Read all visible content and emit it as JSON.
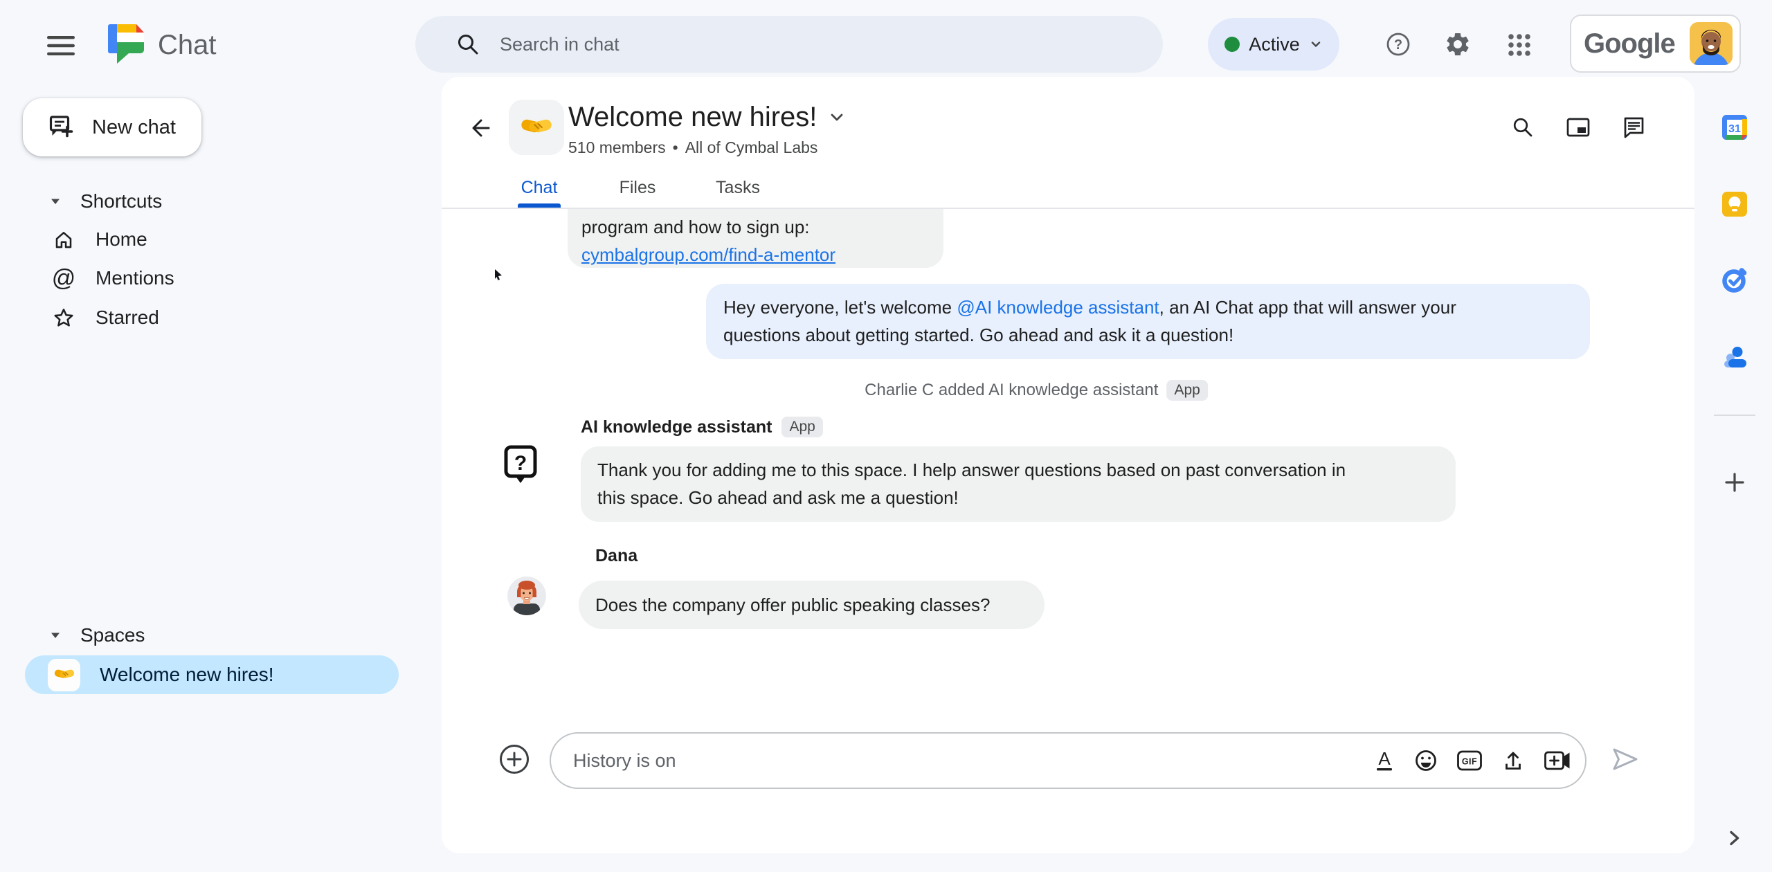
{
  "topbar": {
    "product_name": "Chat",
    "search_placeholder": "Search in chat",
    "status_label": "Active",
    "google_wordmark": "Google"
  },
  "sidebar": {
    "caret": "▾",
    "new_chat_label": "New chat",
    "shortcuts_label": "Shortcuts",
    "items": [
      {
        "label": "Home"
      },
      {
        "label": "Mentions"
      },
      {
        "label": "Starred"
      }
    ],
    "spaces_label": "Spaces",
    "space_item": {
      "label": "Welcome new hires!"
    }
  },
  "header": {
    "title": "Welcome new hires!",
    "member_count": "510 members",
    "dot": "•",
    "org": "All of Cymbal Labs",
    "tabs": [
      {
        "label": "Chat"
      },
      {
        "label": "Files"
      },
      {
        "label": "Tasks"
      }
    ],
    "active_tab": "Chat"
  },
  "chat": {
    "clipped_message": {
      "line": "program and how to sign up:",
      "link": "cymbalgroup.com/find-a-mentor"
    },
    "announcement": {
      "pre": "Hey everyone, let's welcome ",
      "mention": "@AI knowledge assistant",
      "post": ", an AI Chat app that will answer your",
      "line2": "questions about getting started.  Go ahead and ask it a question!"
    },
    "system_event": {
      "text": "Charlie C added AI knowledge assistant",
      "badge": "App"
    },
    "ai_message": {
      "sender": "AI knowledge assistant",
      "badge": "App",
      "line1": "Thank you for adding me to this space. I help answer questions based on past conversation in",
      "line2": "this space. Go ahead and ask me a question!"
    },
    "dana_message": {
      "sender": "Dana",
      "text": "Does the company offer public speaking classes?"
    }
  },
  "compose": {
    "placeholder": "History is on"
  },
  "rail": {
    "calendar_day": "31"
  },
  "icons": {
    "help_glyph": "?",
    "ai_glyph": "?",
    "gif_label": "GIF",
    "format_letter": "A",
    "at_glyph": "@",
    "rail_names": [
      "calendar-icon",
      "keep-icon",
      "tasks-icon",
      "contacts-icon",
      "add-icon",
      "chevron-right-icon"
    ]
  },
  "colors": {
    "page_bg": "#f6f8fc",
    "search_bar_bg": "#e9eef6",
    "status_chip_bg": "#e2e9fb",
    "active_dot_green": "#1e8e3e",
    "selected_space_bg": "#c2e7ff",
    "announcement_bubble_bg": "#e8f0fd",
    "message_bubble_bg": "#f0f1f1",
    "accent_blue": "#0b57d0",
    "link_blue": "#1a73e8"
  }
}
